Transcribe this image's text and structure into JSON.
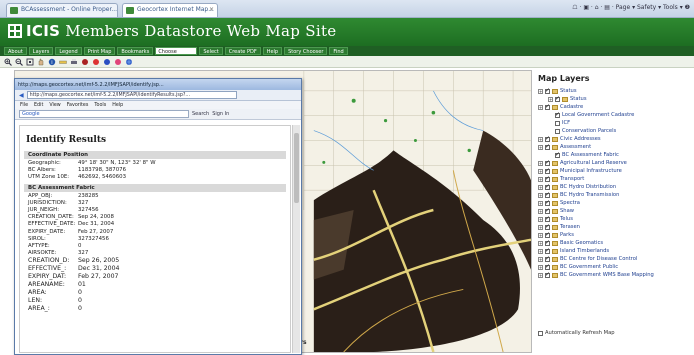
{
  "browser": {
    "tabs": [
      {
        "label": "BCAssessment - Online Proper..."
      },
      {
        "label": "Geocortex Internet Map..."
      }
    ],
    "commands": "☖ · ▣ · ⌂ · ▤ · Page ▾  Safety ▾  Tools ▾  ❷"
  },
  "app": {
    "brand": "ICIS",
    "title": "Members Datastore Web Map Site"
  },
  "menubar": {
    "items": [
      "About",
      "Layers",
      "Legend",
      "Print Map",
      "Bookmarks"
    ],
    "select_value": "Choose",
    "items_after": [
      "Select",
      "Create PDF",
      "Help",
      "Story Chooser",
      "Find"
    ]
  },
  "toolbar": {
    "icons": [
      "zoom-in-icon",
      "zoom-out-icon",
      "full-extent-icon",
      "pan-icon",
      "identify-icon",
      "measure-icon",
      "print-icon",
      "clear-icon",
      "red-tool-icon",
      "blue-tool-icon",
      "pink-tool-icon",
      "blue-globe-icon"
    ]
  },
  "popup": {
    "window_title": "http://maps.geocortex.net/imf-5.2.2/IMFJSAPI/identify.jsp...",
    "url": "http://maps.geocortex.net/imf-5.2.2/IMFJSAPI/identifyResults.jsp?...",
    "menu": [
      "File",
      "Edit",
      "View",
      "Favorites",
      "Tools",
      "Help"
    ],
    "search": {
      "engine": "Google",
      "button": "Search",
      "extra": "Sign In"
    },
    "title": "Identify Results",
    "coord_header": "Coordinate Position",
    "coords": [
      {
        "key": "Geographic:",
        "value": "49° 18' 30\" N, 123° 32' 8\" W"
      },
      {
        "key": "BC Albers:",
        "value": "1183798, 387076"
      },
      {
        "key": "UTM Zone 10E:",
        "value": "462692, 5460603"
      }
    ],
    "assess_header": "BC Assessment Fabric",
    "attributes": [
      {
        "key": "APP_OBJ:",
        "value": "238285"
      },
      {
        "key": "JURISDICTION:",
        "value": "327"
      },
      {
        "key": "JUR_NEIGH:",
        "value": "327456"
      },
      {
        "key": "CREATION_DATE:",
        "value": "Sep 24, 2008"
      },
      {
        "key": "EFFECTIVE_DATE:",
        "value": "Dec 31, 2004"
      },
      {
        "key": "EXPIRY_DATE:",
        "value": "Feb 27, 2007"
      },
      {
        "key": "SIROL:",
        "value": "327327456"
      },
      {
        "key": "AFTYPE:",
        "value": "0"
      },
      {
        "key": "AIRSOKTE:",
        "value": "327"
      }
    ],
    "attributes_big": [
      {
        "key": "CREATION_D:",
        "value": "Sep 26, 2005"
      },
      {
        "key": "EFFECTIVE_:",
        "value": "Dec 31, 2004"
      },
      {
        "key": "EXPIRY_DAT:",
        "value": "Feb 27, 2007"
      },
      {
        "key": "AREANAME:",
        "value": "01"
      },
      {
        "key": "AREA:",
        "value": "0"
      },
      {
        "key": "LEN:",
        "value": "0"
      },
      {
        "key": "AREA_:",
        "value": "0"
      }
    ]
  },
  "map": {
    "footer": "ers"
  },
  "layers": {
    "title": "Map Layers",
    "items": [
      {
        "label": "Status",
        "level": 0,
        "checked": true,
        "folder": true
      },
      {
        "label": "Status",
        "level": 1,
        "checked": true,
        "folder": true
      },
      {
        "label": "Cadastre",
        "level": 0,
        "checked": true,
        "folder": true
      },
      {
        "label": "Local Government Cadastre",
        "level": 1,
        "checked": true,
        "folder": false
      },
      {
        "label": "ICF",
        "level": 1,
        "checked": false,
        "folder": false
      },
      {
        "label": "Conservation Parcels",
        "level": 1,
        "checked": false,
        "folder": false
      },
      {
        "label": "Civic Addresses",
        "level": 0,
        "checked": true,
        "folder": true
      },
      {
        "label": "Assessment",
        "level": 0,
        "checked": true,
        "folder": true
      },
      {
        "label": "BC Assessment Fabric",
        "level": 1,
        "checked": true,
        "folder": false
      },
      {
        "label": "Agricultural Land Reserve",
        "level": 0,
        "checked": true,
        "folder": true
      },
      {
        "label": "Municipal Infrastructure",
        "level": 0,
        "checked": true,
        "folder": true
      },
      {
        "label": "Transport",
        "level": 0,
        "checked": true,
        "folder": true
      },
      {
        "label": "BC Hydro Distribution",
        "level": 0,
        "checked": true,
        "folder": true
      },
      {
        "label": "BC Hydro Transmission",
        "level": 0,
        "checked": true,
        "folder": true
      },
      {
        "label": "Spectra",
        "level": 0,
        "checked": true,
        "folder": true
      },
      {
        "label": "Shaw",
        "level": 0,
        "checked": true,
        "folder": true
      },
      {
        "label": "Telus",
        "level": 0,
        "checked": true,
        "folder": true
      },
      {
        "label": "Terasen",
        "level": 0,
        "checked": true,
        "folder": true
      },
      {
        "label": "Parks",
        "level": 0,
        "checked": true,
        "folder": true
      },
      {
        "label": "Basic Geomatics",
        "level": 0,
        "checked": true,
        "folder": true
      },
      {
        "label": "Island Timberlands",
        "level": 0,
        "checked": true,
        "folder": true
      },
      {
        "label": "BC Centre for Disease Control",
        "level": 0,
        "checked": true,
        "folder": true
      },
      {
        "label": "BC Government Public",
        "level": 0,
        "checked": true,
        "folder": true
      },
      {
        "label": "BC Government WMS Base Mapping",
        "level": 0,
        "checked": true,
        "folder": true
      }
    ],
    "refresh_label": "Automatically Refresh Map"
  },
  "colors": {
    "header_green": "#2f8a31",
    "menubar_green": "#1f5f24",
    "layer_text": "#1f3f8f",
    "parcel_dark": "#2a1f18",
    "map_bg": "#f4f1e6"
  }
}
